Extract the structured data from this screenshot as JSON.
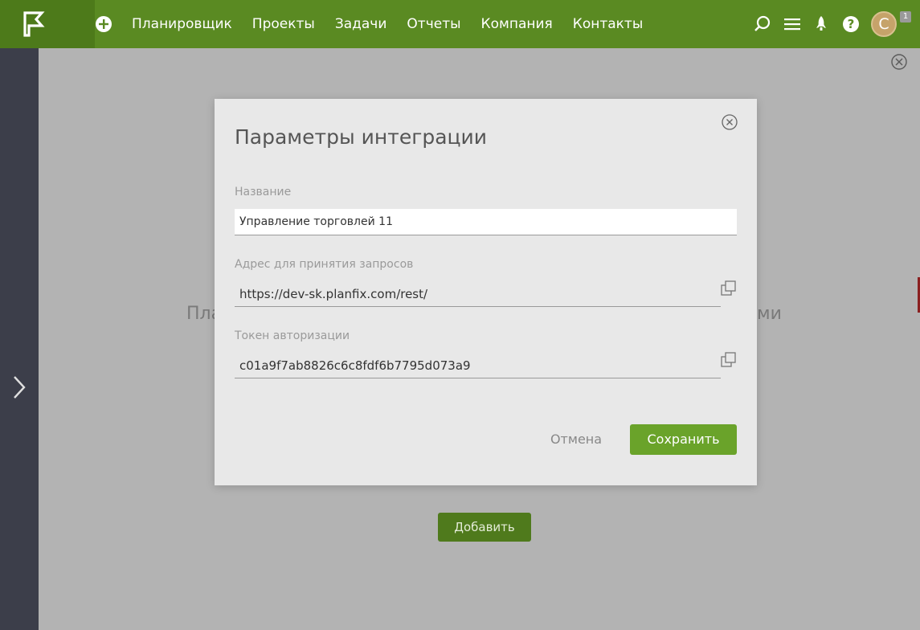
{
  "nav": {
    "items": [
      {
        "label": "Планировщик"
      },
      {
        "label": "Проекты"
      },
      {
        "label": "Задачи"
      },
      {
        "label": "Отчеты"
      },
      {
        "label": "Компания"
      },
      {
        "label": "Контакты"
      }
    ]
  },
  "user": {
    "avatar_letter": "С",
    "badge": "1"
  },
  "icons": {
    "logo": "flag-icon",
    "add": "plus-circle-icon",
    "search": "search-icon",
    "menu": "hamburger-icon",
    "rocket": "rocket-icon",
    "help": "question-icon",
    "close": "close-circle-icon",
    "copy": "copy-icon",
    "sidebar_toggle": "chevron-right-icon"
  },
  "background": {
    "text_left": "Пла",
    "text_right": "ми",
    "add_button": "Добавить"
  },
  "modal": {
    "title": "Параметры интеграции",
    "name_label": "Название",
    "name_value": "Управление торговлей 11",
    "url_label": "Адрес для принятия запросов",
    "url_value": "https://dev-sk.planfix.com/rest/",
    "token_label": "Токен авторизации",
    "token_value": "c01a9f7ab8826c6c8fdf6b7795d073a9",
    "cancel_label": "Отмена",
    "save_label": "Сохранить"
  },
  "colors": {
    "topbar": "#5a8a22",
    "accent_button": "#6aa32a",
    "sidebar": "#3c3e4a",
    "overlay_bg": "#b3b3b3",
    "modal_bg": "#e8e8e8"
  }
}
